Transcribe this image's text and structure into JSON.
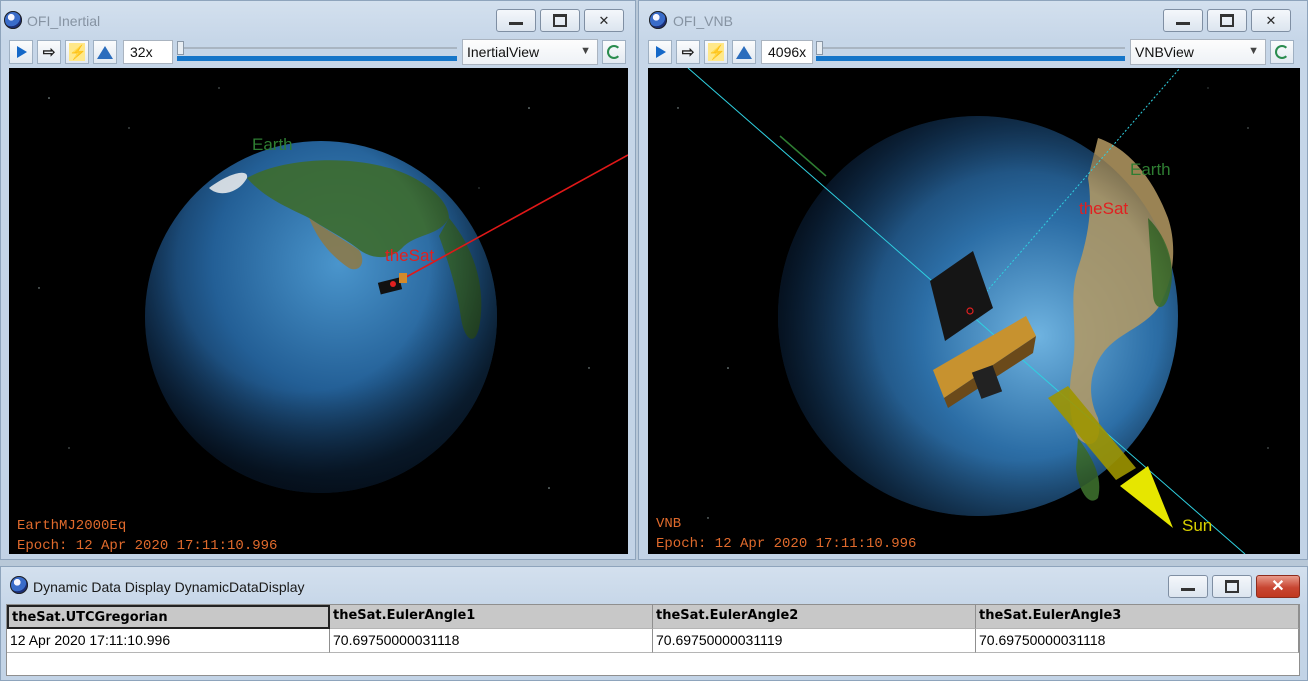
{
  "windows": {
    "inertial": {
      "title": "OFI_Inertial",
      "speed": "32x",
      "view": "InertialView",
      "labels": {
        "earth": "Earth",
        "sat": "theSat"
      },
      "overlay": {
        "frame": "EarthMJ2000Eq",
        "epoch": "Epoch: 12 Apr 2020 17:11:10.996"
      }
    },
    "vnb": {
      "title": "OFI_VNB",
      "speed": "4096x",
      "view": "VNBView",
      "labels": {
        "earth": "Earth",
        "sat": "theSat",
        "sun": "Sun"
      },
      "overlay": {
        "frame": "VNB",
        "epoch": "Epoch: 12 Apr 2020 17:11:10.996"
      }
    },
    "ddd": {
      "title": "Dynamic Data Display DynamicDataDisplay",
      "headers": [
        "theSat.UTCGregorian",
        "theSat.EulerAngle1",
        "theSat.EulerAngle2",
        "theSat.EulerAngle3"
      ],
      "rows": [
        [
          "12 Apr 2020 17:11:10.996",
          "70.69750000031118",
          "70.69750000031119",
          "70.69750000031118"
        ]
      ]
    }
  },
  "colors": {
    "overlay_text": "#e06a2c",
    "sat_label": "#e02020",
    "earth_label": "#2e7d32",
    "sun_label": "#d8d000",
    "space": "#000000"
  },
  "icons": [
    "app-globe-icon",
    "play-icon",
    "step-icon",
    "lightning-icon",
    "mountain-icon",
    "sync-icon",
    "minimize-icon",
    "maximize-icon",
    "close-icon"
  ]
}
